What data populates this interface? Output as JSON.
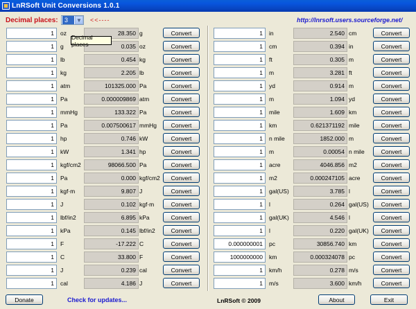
{
  "window": {
    "title": "LnRSoft Unit Conversions 1.0.1"
  },
  "top": {
    "decimal_label": "Decimal places:",
    "decimal_value": "3",
    "arrow_text": "<<----",
    "link": "http://lnrsoft.users.sourceforge.net/",
    "tooltip": "Decimal places"
  },
  "button_label": "Convert",
  "left_rows": [
    {
      "input": "1",
      "from": "oz",
      "output": "28.350",
      "to": "g"
    },
    {
      "input": "1",
      "from": "g",
      "output": "0.035",
      "to": "oz"
    },
    {
      "input": "1",
      "from": "lb",
      "output": "0.454",
      "to": "kg"
    },
    {
      "input": "1",
      "from": "kg",
      "output": "2.205",
      "to": "lb"
    },
    {
      "input": "1",
      "from": "atm",
      "output": "101325.000",
      "to": "Pa"
    },
    {
      "input": "1",
      "from": "Pa",
      "output": "0.000009869",
      "to": "atm"
    },
    {
      "input": "1",
      "from": "mmHg",
      "output": "133.322",
      "to": "Pa"
    },
    {
      "input": "1",
      "from": "Pa",
      "output": "0.007500617",
      "to": "mmHg"
    },
    {
      "input": "1",
      "from": "hp",
      "output": "0.746",
      "to": "kW"
    },
    {
      "input": "1",
      "from": "kW",
      "output": "1.341",
      "to": "hp"
    },
    {
      "input": "1",
      "from": "kgf/cm2",
      "output": "98066.500",
      "to": "Pa"
    },
    {
      "input": "1",
      "from": "Pa",
      "output": "0.000",
      "to": "kgf/cm2"
    },
    {
      "input": "1",
      "from": "kgf·m",
      "output": "9.807",
      "to": "J"
    },
    {
      "input": "1",
      "from": "J",
      "output": "0.102",
      "to": "kgf·m"
    },
    {
      "input": "1",
      "from": "lbf/in2",
      "output": "6.895",
      "to": "kPa"
    },
    {
      "input": "1",
      "from": "kPa",
      "output": "0.145",
      "to": "lbf/in2"
    },
    {
      "input": "1",
      "from": "F",
      "output": "-17.222",
      "to": "C"
    },
    {
      "input": "1",
      "from": "C",
      "output": "33.800",
      "to": "F"
    },
    {
      "input": "1",
      "from": "J",
      "output": "0.239",
      "to": "cal"
    },
    {
      "input": "1",
      "from": "cal",
      "output": "4.186",
      "to": "J"
    }
  ],
  "right_rows": [
    {
      "input": "1",
      "from": "in",
      "output": "2.540",
      "to": "cm"
    },
    {
      "input": "1",
      "from": "cm",
      "output": "0.394",
      "to": "in"
    },
    {
      "input": "1",
      "from": "ft",
      "output": "0.305",
      "to": "m"
    },
    {
      "input": "1",
      "from": "m",
      "output": "3.281",
      "to": "ft"
    },
    {
      "input": "1",
      "from": "yd",
      "output": "0.914",
      "to": "m"
    },
    {
      "input": "1",
      "from": "m",
      "output": "1.094",
      "to": "yd"
    },
    {
      "input": "1",
      "from": "mile",
      "output": "1.609",
      "to": "km"
    },
    {
      "input": "1",
      "from": "km",
      "output": "0.621371192",
      "to": "mile"
    },
    {
      "input": "1",
      "from": "n mile",
      "output": "1852.000",
      "to": "m"
    },
    {
      "input": "1",
      "from": "m",
      "output": "0.00054",
      "to": "n mile"
    },
    {
      "input": "1",
      "from": "acre",
      "output": "4046.856",
      "to": "m2"
    },
    {
      "input": "1",
      "from": "m2",
      "output": "0.000247105",
      "to": "acre"
    },
    {
      "input": "1",
      "from": "gal(US)",
      "output": "3.785",
      "to": "l"
    },
    {
      "input": "1",
      "from": "l",
      "output": "0.264",
      "to": "gal(US)"
    },
    {
      "input": "1",
      "from": "gal(UK)",
      "output": "4.546",
      "to": "l"
    },
    {
      "input": "1",
      "from": "l",
      "output": "0.220",
      "to": "gal(UK)"
    },
    {
      "input": "0.000000001",
      "from": "pc",
      "output": "30856.740",
      "to": "km"
    },
    {
      "input": "1000000000",
      "from": "km",
      "output": "0.000324078",
      "to": "pc"
    },
    {
      "input": "1",
      "from": "km/h",
      "output": "0.278",
      "to": "m/s"
    },
    {
      "input": "1",
      "from": "m/s",
      "output": "3.600",
      "to": "km/h"
    }
  ],
  "footer": {
    "donate": "Donate",
    "check_updates": "Check for updates...",
    "copyright": "LnRSoft © 2009",
    "about": "About",
    "exit": "Exit"
  }
}
